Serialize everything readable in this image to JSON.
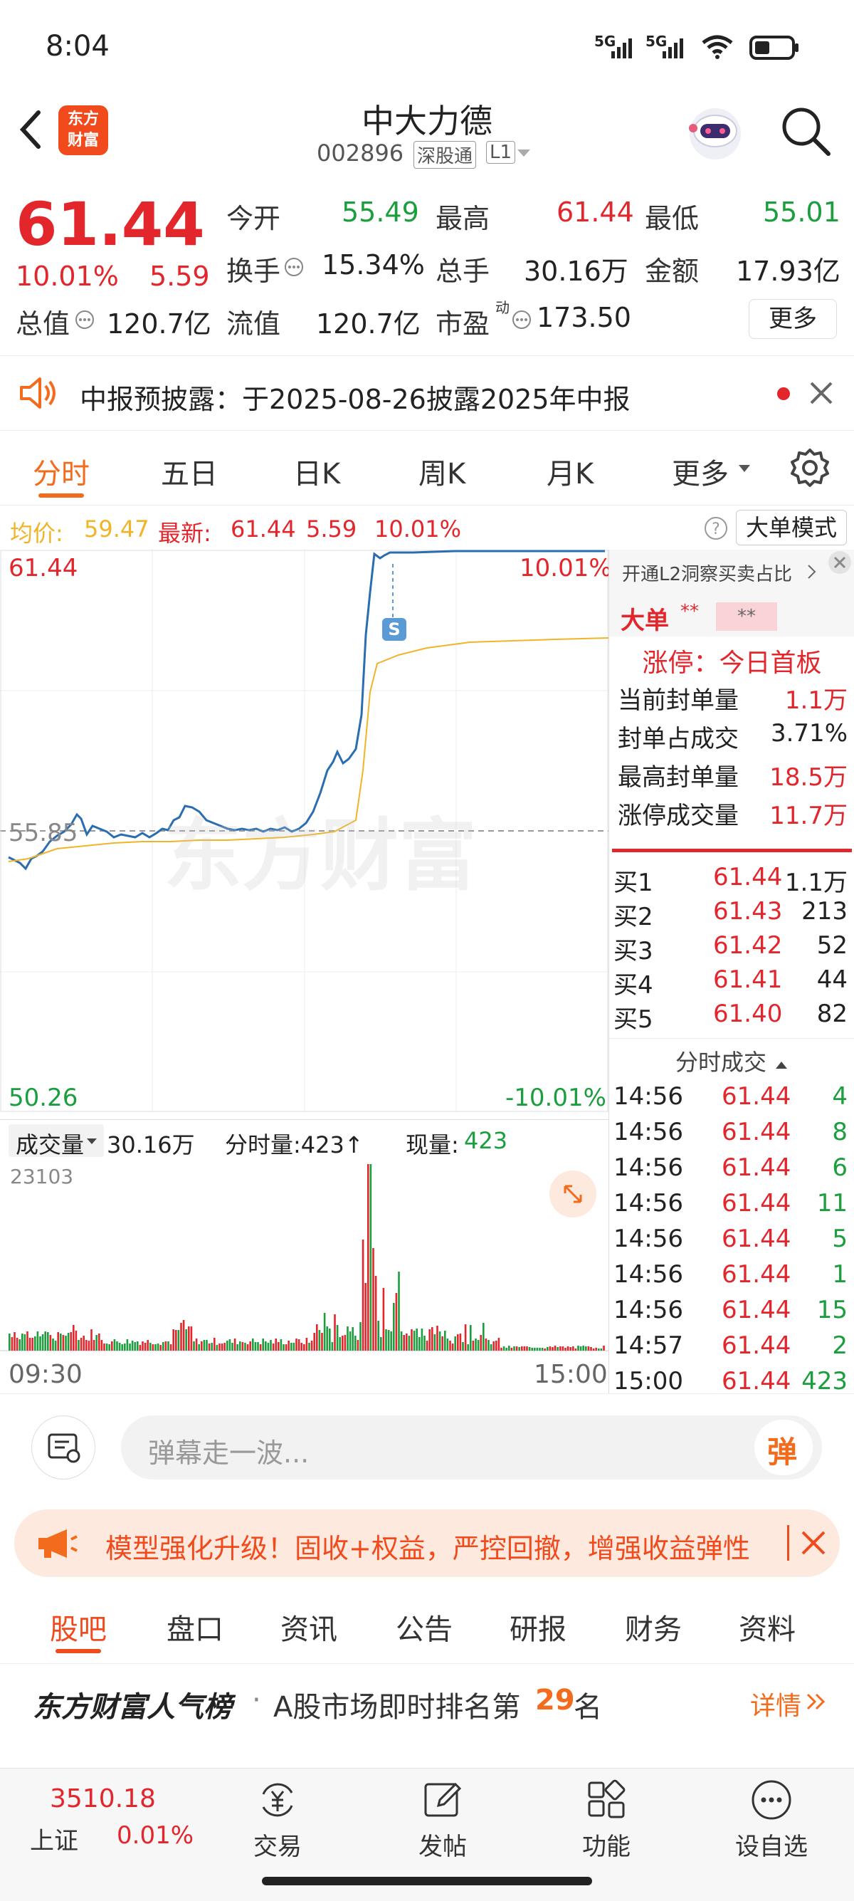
{
  "status": {
    "time": "8:04",
    "sig1": "5G",
    "sig2": "5G"
  },
  "header": {
    "logo_l1": "东方",
    "logo_l2": "财富",
    "title": "中大力德",
    "code": "002896",
    "tag1": "深股通",
    "tag2": "L1"
  },
  "quote": {
    "price": "61.44",
    "pct": "10.01%",
    "chg": "5.59",
    "open_label": "今开",
    "open": "55.49",
    "high_label": "最高",
    "high": "61.44",
    "low_label": "最低",
    "low": "55.01",
    "turnover_label": "换手",
    "turnover": "15.34%",
    "vol_label": "总手",
    "vol": "30.16万",
    "amount_label": "金额",
    "amount": "17.93亿",
    "mcap_label": "总值",
    "mcap": "120.7亿",
    "float_label": "流值",
    "float": "120.7亿",
    "pe_label": "市盈",
    "pe_sup": "动",
    "pe": "173.50",
    "more": "更多"
  },
  "notice": {
    "text": "中报预披露：于2025-08-26披露2025年中报"
  },
  "tabs": [
    "分时",
    "五日",
    "日K",
    "周K",
    "月K",
    "更多"
  ],
  "infoline": {
    "avg_label": "均价:",
    "avg": "59.47",
    "last_label": "最新:",
    "last": "61.44",
    "chg": "5.59",
    "pct": "10.01%",
    "mode": "大单模式"
  },
  "chart": {
    "ymax": "61.44",
    "ymax_pct": "10.01%",
    "ymid": "55.85",
    "ymin": "50.26",
    "ymin_pct": "-10.01%",
    "s_mark": "S",
    "watermark": "东方财富",
    "vol_label": "成交量",
    "vol_total": "30.16万",
    "vol_min_label": "分时量:423↑",
    "vol_now_label": "现量:",
    "vol_now": "423",
    "vol_max": "23103",
    "t_start": "09:30",
    "t_end": "15:00"
  },
  "side": {
    "l2_text": "开通L2洞察买卖占比",
    "big_label": "大单",
    "big_stars1": "**",
    "big_stars2": "**",
    "limit_title": "涨停：今日首板",
    "stats": [
      {
        "label": "当前封单量",
        "value": "1.1万"
      },
      {
        "label": "封单占成交",
        "value": "3.71%"
      },
      {
        "label": "最高封单量",
        "value": "18.5万"
      },
      {
        "label": "涨停成交量",
        "value": "11.7万"
      }
    ],
    "bids": [
      {
        "label": "买1",
        "price": "61.44",
        "vol": "1.1万"
      },
      {
        "label": "买2",
        "price": "61.43",
        "vol": "213"
      },
      {
        "label": "买3",
        "price": "61.42",
        "vol": "52"
      },
      {
        "label": "买4",
        "price": "61.41",
        "vol": "44"
      },
      {
        "label": "买5",
        "price": "61.40",
        "vol": "82"
      }
    ],
    "ticks_title": "分时成交",
    "ticks": [
      {
        "t": "14:56",
        "p": "61.44",
        "v": "4"
      },
      {
        "t": "14:56",
        "p": "61.44",
        "v": "8"
      },
      {
        "t": "14:56",
        "p": "61.44",
        "v": "6"
      },
      {
        "t": "14:56",
        "p": "61.44",
        "v": "11"
      },
      {
        "t": "14:56",
        "p": "61.44",
        "v": "5"
      },
      {
        "t": "14:56",
        "p": "61.44",
        "v": "1"
      },
      {
        "t": "14:56",
        "p": "61.44",
        "v": "15"
      },
      {
        "t": "14:57",
        "p": "61.44",
        "v": "2"
      },
      {
        "t": "15:00",
        "p": "61.44",
        "v": "423"
      }
    ]
  },
  "danmu": {
    "placeholder": "弹幕走一波...",
    "btn": "弹"
  },
  "banner": {
    "text": "模型强化升级！固收+权益，严控回撤，增强收益弹性"
  },
  "ftabs": [
    "股吧",
    "盘口",
    "资讯",
    "公告",
    "研报",
    "财务",
    "资料"
  ],
  "rank": {
    "title": "东方财富人气榜",
    "text": "A股市场即时排名第",
    "num": "29",
    "suffix": "名",
    "detail": "详情"
  },
  "bottom": {
    "index_value": "3510.18",
    "index_name": "上证",
    "index_pct": "0.01%",
    "nav": [
      "交易",
      "发帖",
      "功能",
      "设自选"
    ]
  },
  "colors": {
    "up": "#e3262c",
    "down": "#1b9e3e",
    "accent": "#f36b1c",
    "line": "#2a6db0",
    "avgline": "#f0b429"
  }
}
